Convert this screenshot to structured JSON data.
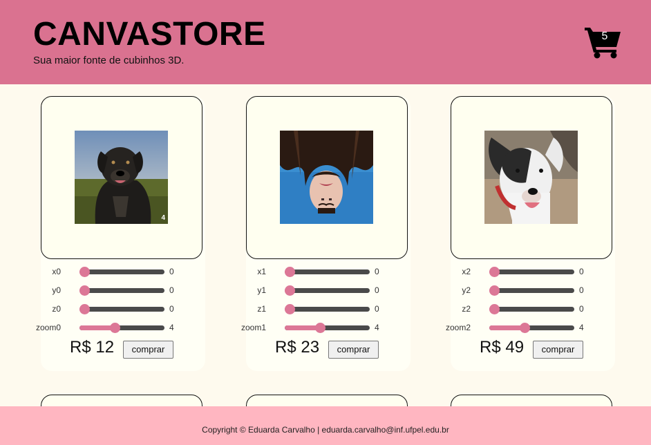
{
  "header": {
    "title": "CANVASTORE",
    "subtitle": "Sua maior fonte de cubinhos 3D.",
    "cart_icon": "shopping-cart-icon",
    "cart_count": "5",
    "bg_color": "#da7290"
  },
  "products": [
    {
      "image": "dog-photo",
      "image_badge": "4",
      "controls": [
        {
          "label": "x0",
          "value": "0",
          "level": 0.0
        },
        {
          "label": "y0",
          "value": "0",
          "level": 0.0
        },
        {
          "label": "z0",
          "value": "0",
          "level": 0.0
        },
        {
          "label": "zoom0",
          "value": "4",
          "level": 0.36
        }
      ],
      "price": "R$ 12",
      "buy_label": "comprar"
    },
    {
      "image": "woman-upside-down-photo",
      "controls": [
        {
          "label": "x1",
          "value": "0",
          "level": 0.0
        },
        {
          "label": "y1",
          "value": "0",
          "level": 0.0
        },
        {
          "label": "z1",
          "value": "0",
          "level": 0.0
        },
        {
          "label": "zoom1",
          "value": "4",
          "level": 0.36
        }
      ],
      "price": "R$ 23",
      "buy_label": "comprar"
    },
    {
      "image": "puppy-photo",
      "controls": [
        {
          "label": "x2",
          "value": "0",
          "level": 0.0
        },
        {
          "label": "y2",
          "value": "0",
          "level": 0.0
        },
        {
          "label": "z2",
          "value": "0",
          "level": 0.0
        },
        {
          "label": "zoom2",
          "value": "4",
          "level": 0.36
        }
      ],
      "price": "R$ 49",
      "buy_label": "comprar"
    }
  ],
  "footer": {
    "text": "Copyright © Eduarda Carvalho | eduarda.carvalho@inf.ufpel.edu.br",
    "bg_color": "#ffb6c1"
  },
  "colors": {
    "accent": "#dc7796",
    "page_bg": "#fefaee",
    "track": "#4a4a4a"
  }
}
